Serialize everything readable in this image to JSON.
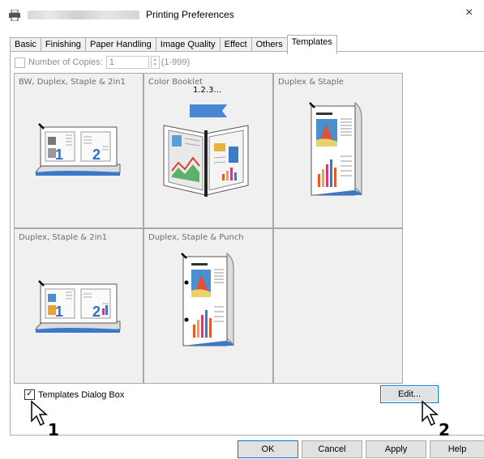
{
  "window": {
    "title": "Printing Preferences",
    "close_glyph": "×"
  },
  "tabs": [
    "Basic",
    "Finishing",
    "Paper Handling",
    "Image Quality",
    "Effect",
    "Others",
    "Templates"
  ],
  "copies": {
    "label": "Number of Copies:",
    "value": "1",
    "range": "(1-999)"
  },
  "templates": [
    {
      "label": "BW, Duplex, Staple & 2in1"
    },
    {
      "label": "Color Booklet",
      "order_text": "1.2.3..."
    },
    {
      "label": "Duplex & Staple"
    },
    {
      "label": "Duplex, Staple & 2in1"
    },
    {
      "label": "Duplex, Staple & Punch"
    }
  ],
  "dialog_box_checkbox": {
    "label": "Templates Dialog Box",
    "checked": true
  },
  "buttons": {
    "edit": "Edit...",
    "ok": "OK",
    "cancel": "Cancel",
    "apply": "Apply",
    "help": "Help"
  },
  "cursor_callouts": [
    "1",
    "2"
  ]
}
